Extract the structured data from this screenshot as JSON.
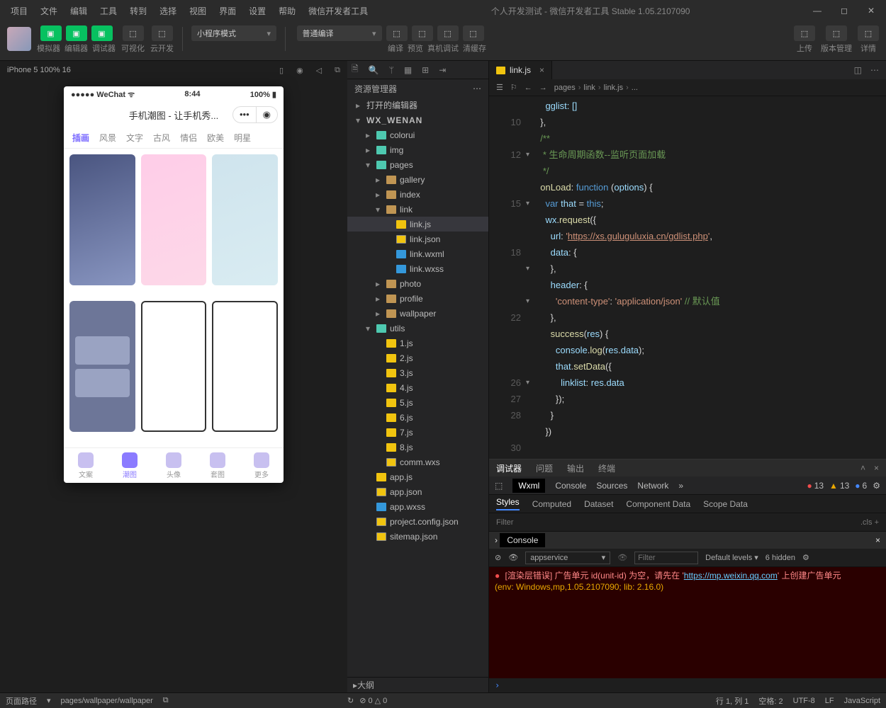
{
  "menus": [
    "项目",
    "文件",
    "编辑",
    "工具",
    "转到",
    "选择",
    "视图",
    "界面",
    "设置",
    "帮助",
    "微信开发者工具"
  ],
  "title": "个人开发测试 - 微信开发者工具 Stable 1.05.2107090",
  "toolbar": {
    "groups": [
      {
        "labels": [
          "模拟器",
          "编辑器",
          "调试器"
        ],
        "green": true
      },
      {
        "labels": [
          "可视化"
        ],
        "green": false
      },
      {
        "labels": [
          "云开发"
        ],
        "green": false
      }
    ],
    "combo1": "小程序模式",
    "combo2": "普通编译",
    "mid": [
      "编译",
      "预览",
      "真机调试",
      "清缓存"
    ],
    "right": [
      "上传",
      "版本管理",
      "详情"
    ]
  },
  "simbar": {
    "device": "iPhone 5 100% 16",
    "icons": [
      "▯",
      "◉",
      "◁",
      "⧉"
    ]
  },
  "phone": {
    "status": {
      "l": "●●●●● WeChat",
      "wifi": "⌃",
      "time": "8:44",
      "batt": "100%"
    },
    "title": "手机潮图 - 让手机秀...",
    "tabs": [
      "插画",
      "风景",
      "文字",
      "古风",
      "情侣",
      "欧美",
      "明星"
    ],
    "tabActive": 0,
    "bottom": [
      {
        "t": "文案"
      },
      {
        "t": "潮图"
      },
      {
        "t": "头像"
      },
      {
        "t": "套图"
      },
      {
        "t": "更多"
      }
    ],
    "bottomActive": 1
  },
  "explorer": {
    "title": "资源管理器",
    "sections": [
      {
        "t": "打开的编辑器",
        "open": false,
        "ind": 12
      },
      {
        "t": "WX_WENAN",
        "open": true,
        "ind": 12,
        "bold": true
      }
    ],
    "tree": [
      {
        "ind": 26,
        "ar": "▸",
        "ic": "fo",
        "t": "colorui"
      },
      {
        "ind": 26,
        "ar": "▸",
        "ic": "fo",
        "t": "img"
      },
      {
        "ind": 26,
        "ar": "▾",
        "ic": "fo",
        "t": "pages"
      },
      {
        "ind": 40,
        "ar": "▸",
        "ic": "f",
        "t": "gallery"
      },
      {
        "ind": 40,
        "ar": "▸",
        "ic": "f",
        "t": "index"
      },
      {
        "ind": 40,
        "ar": "▾",
        "ic": "f",
        "t": "link"
      },
      {
        "ind": 54,
        "ic": "js",
        "t": "link.js",
        "sel": true
      },
      {
        "ind": 54,
        "ic": "json",
        "t": "link.json"
      },
      {
        "ind": 54,
        "ic": "wxml",
        "t": "link.wxml"
      },
      {
        "ind": 54,
        "ic": "wxss",
        "t": "link.wxss"
      },
      {
        "ind": 40,
        "ar": "▸",
        "ic": "f",
        "t": "photo"
      },
      {
        "ind": 40,
        "ar": "▸",
        "ic": "f",
        "t": "profile"
      },
      {
        "ind": 40,
        "ar": "▸",
        "ic": "f",
        "t": "wallpaper"
      },
      {
        "ind": 26,
        "ar": "▾",
        "ic": "fo",
        "t": "utils"
      },
      {
        "ind": 40,
        "ic": "js",
        "t": "1.js"
      },
      {
        "ind": 40,
        "ic": "js",
        "t": "2.js"
      },
      {
        "ind": 40,
        "ic": "js",
        "t": "3.js"
      },
      {
        "ind": 40,
        "ic": "js",
        "t": "4.js"
      },
      {
        "ind": 40,
        "ic": "js",
        "t": "5.js"
      },
      {
        "ind": 40,
        "ic": "js",
        "t": "6.js"
      },
      {
        "ind": 40,
        "ic": "js",
        "t": "7.js"
      },
      {
        "ind": 40,
        "ic": "js",
        "t": "8.js"
      },
      {
        "ind": 40,
        "ic": "json",
        "t": "comm.wxs"
      },
      {
        "ind": 26,
        "ic": "js",
        "t": "app.js"
      },
      {
        "ind": 26,
        "ic": "json",
        "t": "app.json"
      },
      {
        "ind": 26,
        "ic": "wxss",
        "t": "app.wxss"
      },
      {
        "ind": 26,
        "ic": "json",
        "t": "project.config.json"
      },
      {
        "ind": 26,
        "ic": "json",
        "t": "sitemap.json"
      }
    ],
    "outline": "大纲"
  },
  "editor": {
    "tab": "link.js",
    "crumb": [
      "pages",
      "link",
      "link.js",
      "..."
    ],
    "lines": [
      {
        "n": "",
        "t": "    gglist: []",
        "cls": "p"
      },
      {
        "n": "10",
        "t": "  },"
      },
      {
        "n": "",
        "t": ""
      },
      {
        "n": "12",
        "t": "  /**",
        "cls": "c",
        "fold": "▾"
      },
      {
        "n": "",
        "t": "   * 生命周期函数--监听页面加载",
        "cls": "c"
      },
      {
        "n": "",
        "t": "   */",
        "cls": "c"
      },
      {
        "n": "15",
        "t": "  onLoad: function (options) {",
        "html": "  <span class=f>onLoad</span>: <span class=k>function</span> (<span class=p>options</span>) {",
        "fold": "▾"
      },
      {
        "n": "",
        "t": "    var that = this;",
        "html": "    <span class=k>var</span> <span class=p>that</span> = <span class=k>this</span>;"
      },
      {
        "n": "",
        "t": "    wx.request({",
        "html": "    <span class=p>wx</span>.<span class=f>request</span>({"
      },
      {
        "n": "18",
        "t": "      url: 'https://xs.guluguluxia.cn/gdlist.php',",
        "html": "      <span class=p>url</span>: <span class=s>'<span class=url>https://xs.guluguluxia.cn/gdlist.php</span>'</span>,"
      },
      {
        "n": "",
        "t": "      data: {",
        "html": "      <span class=p>data</span>: {",
        "fold": "▾"
      },
      {
        "n": "",
        "t": "      },"
      },
      {
        "n": "",
        "t": "      header: {",
        "html": "      <span class=p>header</span>: {",
        "fold": "▾"
      },
      {
        "n": "22",
        "t": "        'content-type': 'application/json' // 默认值",
        "html": "        <span class=s>'content-type'</span>: <span class=s>'application/json'</span> <span class=c>// 默认值</span>"
      },
      {
        "n": "",
        "t": "      },"
      },
      {
        "n": "",
        "t": "      success(res) {",
        "html": "      <span class=f>success</span>(<span class=p>res</span>) {"
      },
      {
        "n": "",
        "t": "        console.log(res.data);",
        "html": "        <span class=p>console</span>.<span class=f>log</span>(<span class=p>res</span>.<span class=p>data</span>);"
      },
      {
        "n": "26",
        "t": "        that.setData({",
        "html": "        <span class=p>that</span>.<span class=f>setData</span>({",
        "fold": "▾"
      },
      {
        "n": "27",
        "t": "          linklist: res.data",
        "html": "          <span class=p>linklist</span>: <span class=p>res</span>.<span class=p>data</span>"
      },
      {
        "n": "28",
        "t": "        });"
      },
      {
        "n": "",
        "t": "      }"
      },
      {
        "n": "30",
        "t": "    })"
      }
    ]
  },
  "devtools": {
    "top": [
      "调试器",
      "问题",
      "输出",
      "终端"
    ],
    "tools": [
      "Wxml",
      "Console",
      "Sources",
      "Network"
    ],
    "badges": {
      "err": "13",
      "warn": "13",
      "info": "6"
    },
    "sub": [
      "Styles",
      "Computed",
      "Dataset",
      "Component Data",
      "Scope Data"
    ],
    "filter_placeholder": "Filter",
    "filter_right": ".cls",
    "console_label": "Console",
    "appsvc": "appservice",
    "defaults": "Default levels",
    "hidden": "6 hidden",
    "error": "[渲染层错误] 广告单元 id(unit-id) 为空，请先在 'https://mp.weixin.qq.com' 上创建广告单元",
    "error_link": "https://mp.weixin.qq.com",
    "env": "(env: Windows,mp,1.05.2107090; lib: 2.16.0)"
  },
  "status": {
    "l1": "页面路径",
    "l2": "pages/wallpaper/wallpaper",
    "mid": "⊘ 0 △ 0",
    "r": [
      "行 1, 列 1",
      "空格: 2",
      "UTF-8",
      "LF",
      "JavaScript"
    ]
  }
}
